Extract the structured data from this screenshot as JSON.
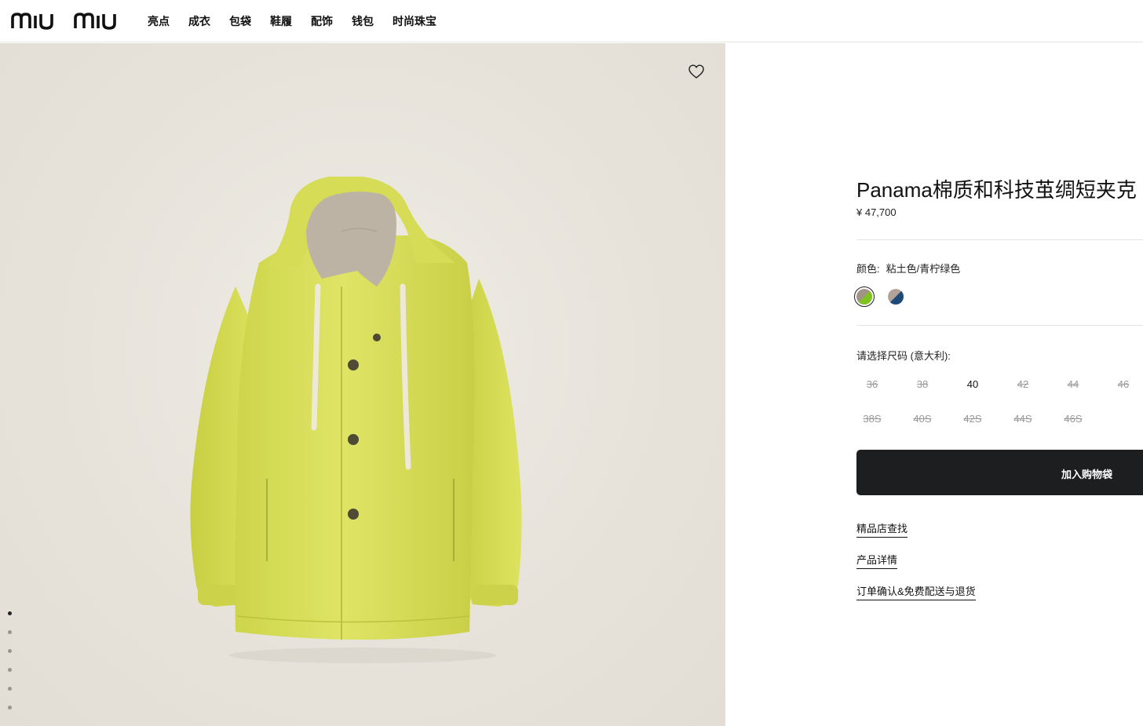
{
  "brand": {
    "logo_text": "MIU MIU"
  },
  "nav": {
    "items": [
      "亮点",
      "成衣",
      "包袋",
      "鞋履",
      "配饰",
      "钱包",
      "时尚珠宝"
    ]
  },
  "gallery": {
    "image_count": 6,
    "active_index": 0,
    "wishlist_icon": "heart-icon"
  },
  "product": {
    "title": "Panama棉质和科技茧绸短夹克",
    "price": "¥ 47,700",
    "color_label": "颜色:",
    "color_value": "粘土色/青柠绿色",
    "swatches": [
      {
        "name": "粘土色/青柠绿色",
        "color_a": "#a09484",
        "color_b": "#7fc41e",
        "selected": true
      },
      {
        "name": "second-color",
        "color_a": "#b3a396",
        "color_b": "#1e4a7a",
        "selected": false
      }
    ],
    "size_label": "请选择尺码 (意大利):",
    "sizes_row1": [
      {
        "label": "36",
        "available": false
      },
      {
        "label": "38",
        "available": false
      },
      {
        "label": "40",
        "available": true
      },
      {
        "label": "42",
        "available": false
      },
      {
        "label": "44",
        "available": false
      },
      {
        "label": "46",
        "available": false
      }
    ],
    "sizes_row2": [
      {
        "label": "38S",
        "available": false
      },
      {
        "label": "40S",
        "available": false
      },
      {
        "label": "42S",
        "available": false
      },
      {
        "label": "44S",
        "available": false
      },
      {
        "label": "46S",
        "available": false
      }
    ],
    "add_to_bag": "加入购物袋",
    "links": [
      "精品店查找",
      "产品详情",
      "订单确认&免费配送与退货"
    ]
  }
}
